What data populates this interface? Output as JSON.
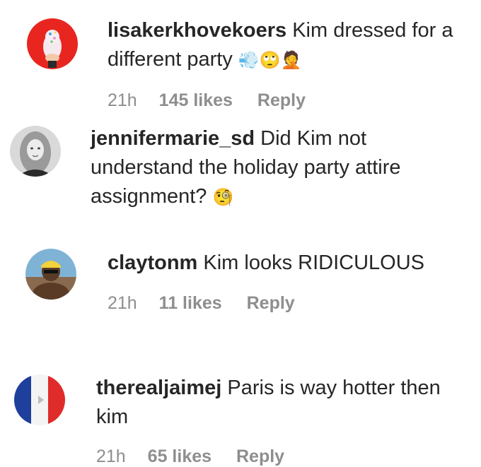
{
  "comments": [
    {
      "username": "lisakerkhovekoers",
      "text": "Kim dressed for a different party",
      "emojis": "💨🙄🤦",
      "time": "21h",
      "likes": "145 likes",
      "reply": "Reply",
      "avatar_icon": "party-cake-avatar"
    },
    {
      "username": "jennifermarie_sd",
      "text": "Did Kim not understand the holiday party attire assignment?",
      "emojis": "🧐",
      "avatar_icon": "portrait-avatar"
    },
    {
      "username": "claytonm",
      "text": "Kim looks RIDICULOUS",
      "time": "21h",
      "likes": "11 likes",
      "reply": "Reply",
      "avatar_icon": "man-cap-avatar"
    },
    {
      "username": "therealjaimej",
      "text": "Paris is way hotter then kim",
      "time": "21h",
      "likes": "65 likes",
      "reply": "Reply",
      "avatar_icon": "french-flag-avatar"
    }
  ],
  "colors": {
    "text": "#262626",
    "meta": "#8e8e8e",
    "background": "#ffffff"
  }
}
